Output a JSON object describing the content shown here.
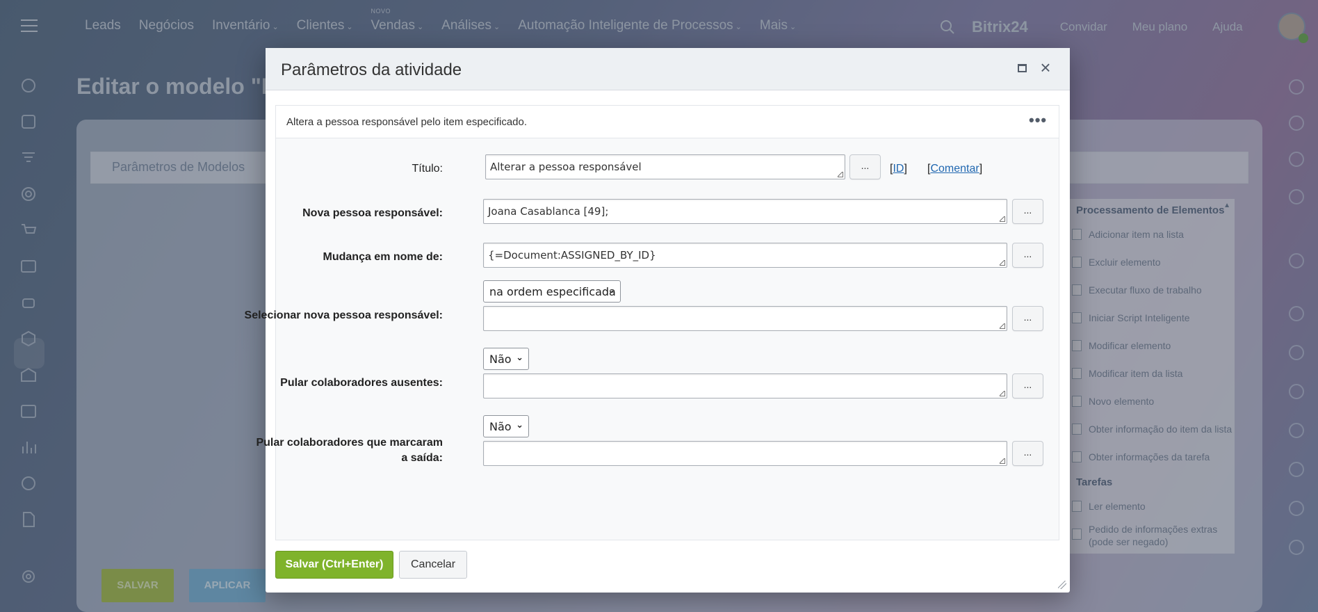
{
  "topnav": {
    "items": [
      "Leads",
      "Negócios",
      "Inventário",
      "Clientes",
      "Vendas",
      "Análises",
      "Automação Inteligente de Processos",
      "Mais"
    ],
    "vendas_badge": "NOVO",
    "brand": "Bitrix24",
    "links": [
      "Convidar",
      "Meu plano",
      "Ajuda"
    ]
  },
  "background": {
    "page_title": "Editar o modelo \"N",
    "tab": "Parâmetros de Modelos",
    "save_button": "SALVAR",
    "apply_button": "APLICAR",
    "palette": {
      "section1": "Processamento de Elementos",
      "items1": [
        "Adicionar item na lista",
        "Excluir elemento",
        "Executar fluxo de trabalho",
        "Iniciar Script Inteligente",
        "Modificar elemento",
        "Modificar item da lista",
        "Novo elemento",
        "Obter informação do item da lista",
        "Obter informações da tarefa"
      ],
      "section2": "Tarefas",
      "items2": [
        "Ler elemento",
        "Pedido de informações extras (pode ser negado)"
      ]
    }
  },
  "dialog": {
    "title": "Parâmetros da atividade",
    "description": "Altera a pessoa responsável pelo item especificado.",
    "more_icon": "•••",
    "fields": {
      "titulo_label": "Título:",
      "titulo_value": "Alterar a pessoa responsável",
      "id_link": "ID",
      "comment_link": "Comentar",
      "nova_label": "Nova pessoa responsável:",
      "nova_value": "Joana Casablanca [49];",
      "mudanca_label": "Mudança em nome de:",
      "mudanca_value": "{=Document:ASSIGNED_BY_ID}",
      "selecionar_label": "Selecionar nova pessoa responsável:",
      "selecionar_option": "na ordem especificada",
      "pular_ausentes_label": "Pular colaboradores ausentes:",
      "pular_ausentes_option": "Não",
      "pular_saida_label_1": "Pular colaboradores que marcaram",
      "pular_saida_label_2": "a saída:",
      "pular_saida_option": "Não"
    },
    "dots": "...",
    "save_button": "Salvar (Ctrl+Enter)",
    "cancel_button": "Cancelar"
  }
}
